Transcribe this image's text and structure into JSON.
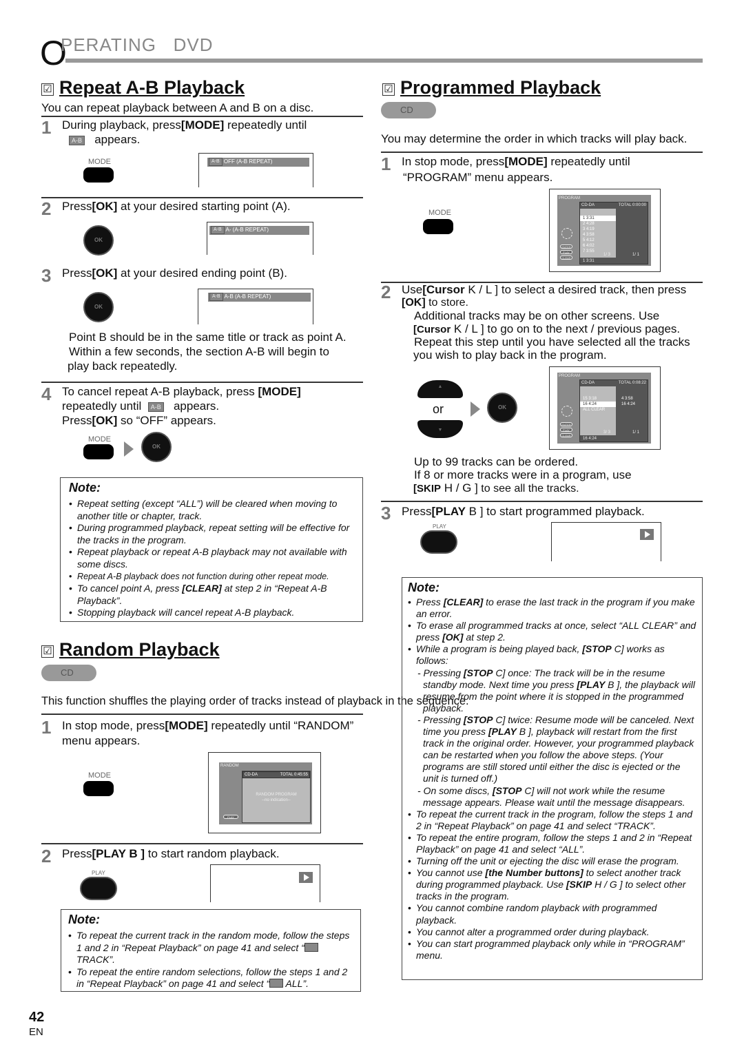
{
  "header": {
    "first": "O",
    "rest": "PERATING   DVD"
  },
  "repeat_ab": {
    "check": "☑",
    "title": "Repeat A-B Playback",
    "intro": "You can repeat playback between A and B on a disc.",
    "ab_icon": "A-B",
    "step1": {
      "num": "1",
      "a": "During playback, press",
      "b": "[MODE]",
      "c": " repeatedly until",
      "d": "appears."
    },
    "mode_label": "MODE",
    "ok_label": "OK",
    "screen1": "OFF  (A-B REPEAT)",
    "step2": {
      "num": "2",
      "a": "Press",
      "b": "[OK]",
      "c": " at your desired starting point (A)."
    },
    "screen2": "A-  (A-B REPEAT)",
    "step3": {
      "num": "3",
      "a": "Press",
      "b": "[OK]",
      "c": " at your desired ending point (B)."
    },
    "screen3": "A-B  (A-B REPEAT)",
    "para": [
      "Point B should be in the same title or track as point A.",
      "Within a few seconds, the section A-B will begin to",
      "play back repeatedly."
    ],
    "step4": {
      "num": "4",
      "a": "To cancel repeat A-B playback, press",
      "b": "[MODE]",
      "c": "repeatedly until",
      "d": "appears.",
      "e": "Press",
      "f": "[OK]",
      "g": " so “OFF” appears."
    },
    "note_title": "Note:",
    "notes": [
      {
        "segs": [
          {
            "text": "Repeat setting (except “ALL”) will be cleared when moving to another title or chapter, track."
          }
        ]
      },
      {
        "segs": [
          {
            "text": "During programmed playback, repeat setting will be effective for the tracks in the program."
          }
        ]
      },
      {
        "segs": [
          {
            "text": "Repeat playback or repeat A-B playback may not available with some discs."
          }
        ]
      },
      {
        "small": true,
        "segs": [
          {
            "text": "Repeat A-B playback does not function during other repeat mode."
          }
        ]
      },
      {
        "segs": [
          {
            "text": "To cancel point A, press "
          },
          {
            "text": "[CLEAR]",
            "bold": true
          },
          {
            "text": " at step 2 in “Repeat A-B Playback”."
          }
        ]
      },
      {
        "segs": [
          {
            "text": "Stopping playback will cancel repeat A-B playback."
          }
        ]
      }
    ]
  },
  "random": {
    "check": "☑",
    "title": "Random Playback",
    "badge": "CD",
    "intro": "This function shuffles the playing order of tracks instead of playback in the sequence.",
    "step1": {
      "num": "1",
      "a": "In stop mode, press",
      "b": "[MODE]",
      "c": " repeatedly until “RANDOM”",
      "d": "menu appears."
    },
    "mode_label": "MODE",
    "menu": {
      "title": "RANDOM",
      "disc": "CD-DA",
      "total": "TOTAL 0:45:55",
      "line1": "RANDOM PROGRAM",
      "line2": "--no indication--",
      "play": "PLAY"
    },
    "step2": {
      "num": "2",
      "a": "Press",
      "b": "[PLAY B ]",
      "c": " to start random playback."
    },
    "play_label": "PLAY",
    "note_title": "Note:",
    "notes": [
      {
        "segs": [
          {
            "text": "To repeat the current track in the random mode, follow the steps 1 and 2 in “Repeat Playback” on page 41 and select “"
          },
          {
            "icon": "repeat-icon"
          },
          {
            "text": " TRACK”."
          }
        ]
      },
      {
        "segs": [
          {
            "text": "To repeat the entire random selections, follow the steps 1 and 2 in “Repeat Playback” on page 41 and select “"
          },
          {
            "icon": "repeat-icon"
          },
          {
            "text": " ALL”."
          }
        ]
      }
    ]
  },
  "programmed": {
    "check": "☑",
    "title": "Programmed Playback",
    "badge": "CD",
    "intro": "You may determine the order in which tracks will play back.",
    "step1": {
      "num": "1",
      "a": "In stop mode, press",
      "b": "[MODE]",
      "c": " repeatedly until",
      "d": "“PROGRAM” menu appears."
    },
    "mode_label": "MODE",
    "menu1": {
      "title": "PROGRAM",
      "disc": "CD-DA",
      "total": "TOTAL  0:00:00",
      "tracks": [
        "1  3:31",
        "2  4:28",
        "3  4:19",
        "4  3:58",
        "5  4:12",
        "6  4:02",
        "7  3:55"
      ],
      "page_left": "1/  3",
      "page_right": "1/  1",
      "footer": "1  3:31",
      "buttons": [
        "ENTER",
        "PLAY",
        "CLEAR"
      ]
    },
    "step2": {
      "num": "2",
      "a": "Use",
      "b": "[Cursor",
      "c": " K / L ]",
      "d": " to select a desired track, then press",
      "e": "[OK]",
      "f": " to store.",
      "g": "Additional tracks may be on other screens. Use",
      "h": "[Cursor",
      "i": " K / L ]",
      "j": " to go on to the next / previous pages.",
      "k": "Repeat this step until you have selected all the tracks",
      "l": "you wish to play back in the program."
    },
    "or": "or",
    "ok_label": "OK",
    "menu2": {
      "title": "PROGRAM",
      "disc": "CD-DA",
      "total": "TOTAL  0:08:22",
      "left": [
        "15  3:18",
        "16  4:24",
        "ALL CLEAR"
      ],
      "right": [
        "4    3:58",
        "16    4:24"
      ],
      "page_left": "3/  3",
      "page_right": "1/  1",
      "footer": "16  4:24",
      "buttons": [
        "ENTER",
        "PLAY",
        "CLEAR"
      ]
    },
    "tip": {
      "a": "Up to 99 tracks can be ordered.",
      "b": "If 8 or more tracks were in a program, use",
      "c": "[SKIP",
      "d": " H  / G ]",
      "e": " to see all the tracks."
    },
    "step3": {
      "num": "3",
      "a": "Press",
      "b": "[PLAY",
      "c": " B ]",
      "d": " to start programmed playback."
    },
    "play_label": "PLAY",
    "note_title": "Note:",
    "notes": [
      {
        "segs": [
          {
            "text": "Press "
          },
          {
            "text": "[CLEAR]",
            "bold": true
          },
          {
            "text": " to erase the last track in the program if you make an error."
          }
        ]
      },
      {
        "segs": [
          {
            "text": "To erase all programmed tracks at once, select “ALL CLEAR” and press "
          },
          {
            "text": "[OK]",
            "bold": true
          },
          {
            "text": " at step 2."
          }
        ]
      },
      {
        "segs": [
          {
            "text": "While a program is being played back, "
          },
          {
            "text": "[STOP",
            "bold": true
          },
          {
            "text": " C] works as follows:"
          }
        ]
      },
      {
        "sub": true,
        "segs": [
          {
            "text": "- Pressing "
          },
          {
            "text": "[STOP",
            "bold": true
          },
          {
            "text": " C] once: The track will be in the resume standby mode. Next time you press "
          },
          {
            "text": "[PLAY",
            "bold": true
          },
          {
            "text": " B ], the playback will resume from the point where it is stopped in the programmed playback."
          }
        ]
      },
      {
        "sub": true,
        "segs": [
          {
            "text": "- Pressing "
          },
          {
            "text": "[STOP",
            "bold": true
          },
          {
            "text": " C] twice: Resume mode will be canceled. Next time you press "
          },
          {
            "text": "[PLAY",
            "bold": true
          },
          {
            "text": " B ], playback will restart from the first track in the original order. However, your programmed playback can be restarted when you follow the above steps. (Your programs are still stored until either the disc is ejected or the unit is turned off.)"
          }
        ]
      },
      {
        "sub": true,
        "segs": [
          {
            "text": "- On some discs, "
          },
          {
            "text": "[STOP",
            "bold": true
          },
          {
            "text": " C] will not work while the resume message appears. Please wait until the message disappears."
          }
        ]
      },
      {
        "segs": [
          {
            "text": "To repeat the current track in the program, follow the steps 1 and 2 in “Repeat Playback” on page 41 and select “TRACK”."
          }
        ]
      },
      {
        "segs": [
          {
            "text": "To repeat the entire program, follow the steps 1 and 2 in “Repeat Playback” on page 41 and select “ALL”."
          }
        ]
      },
      {
        "segs": [
          {
            "text": "Turning off the unit or ejecting the disc will erase the program."
          }
        ]
      },
      {
        "segs": [
          {
            "text": "You cannot use "
          },
          {
            "text": "[the Number buttons]",
            "bold": true
          },
          {
            "text": " to select another track during programmed playback. Use "
          },
          {
            "text": "[SKIP",
            "bold": true
          },
          {
            "text": " H  / G ] to select other tracks in the program."
          }
        ]
      },
      {
        "segs": [
          {
            "text": "You cannot combine random playback with programmed playback."
          }
        ]
      },
      {
        "segs": [
          {
            "text": "You cannot alter a programmed order during playback."
          }
        ]
      },
      {
        "segs": [
          {
            "text": "You can start programmed playback only while in “PROGRAM” menu."
          }
        ]
      }
    ]
  },
  "footer": {
    "page": "42",
    "lang": "EN"
  }
}
